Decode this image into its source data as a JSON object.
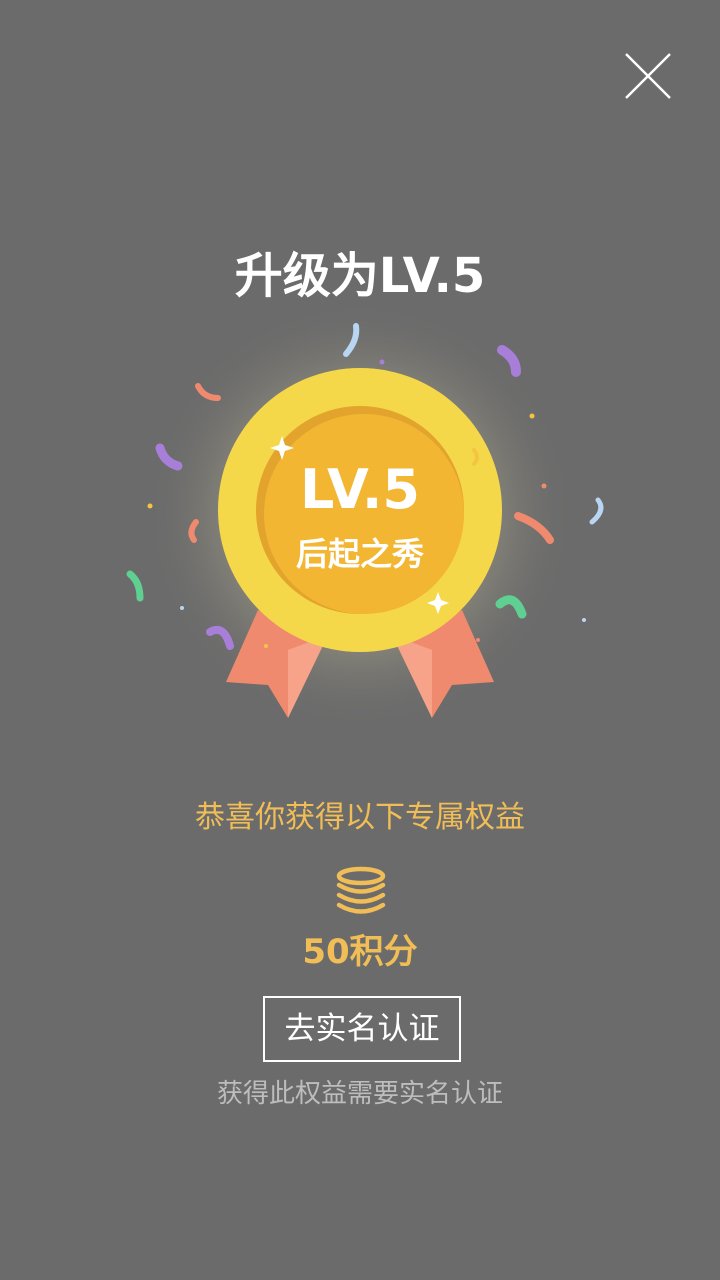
{
  "dialog": {
    "title": "升级为LV.5",
    "close_icon": "close-icon"
  },
  "medal": {
    "level": "LV.5",
    "rank_title": "后起之秀",
    "colors": {
      "outer": "#f5d84a",
      "inner": "#f2b632",
      "ribbon": "#f08a6e",
      "ribbon_light": "#f7a38a",
      "glow": "#e8e0b0"
    }
  },
  "rewards": {
    "heading": "恭喜你获得以下专属权益",
    "icon": "coin-stack-icon",
    "points_label": "50积分"
  },
  "verify": {
    "button_label": "去实名认证",
    "hint": "获得此权益需要实名认证"
  },
  "colors": {
    "background": "#6b6b6b",
    "accent": "#f0bd56",
    "text": "#ffffff",
    "hint_text": "#bdbdbd"
  }
}
